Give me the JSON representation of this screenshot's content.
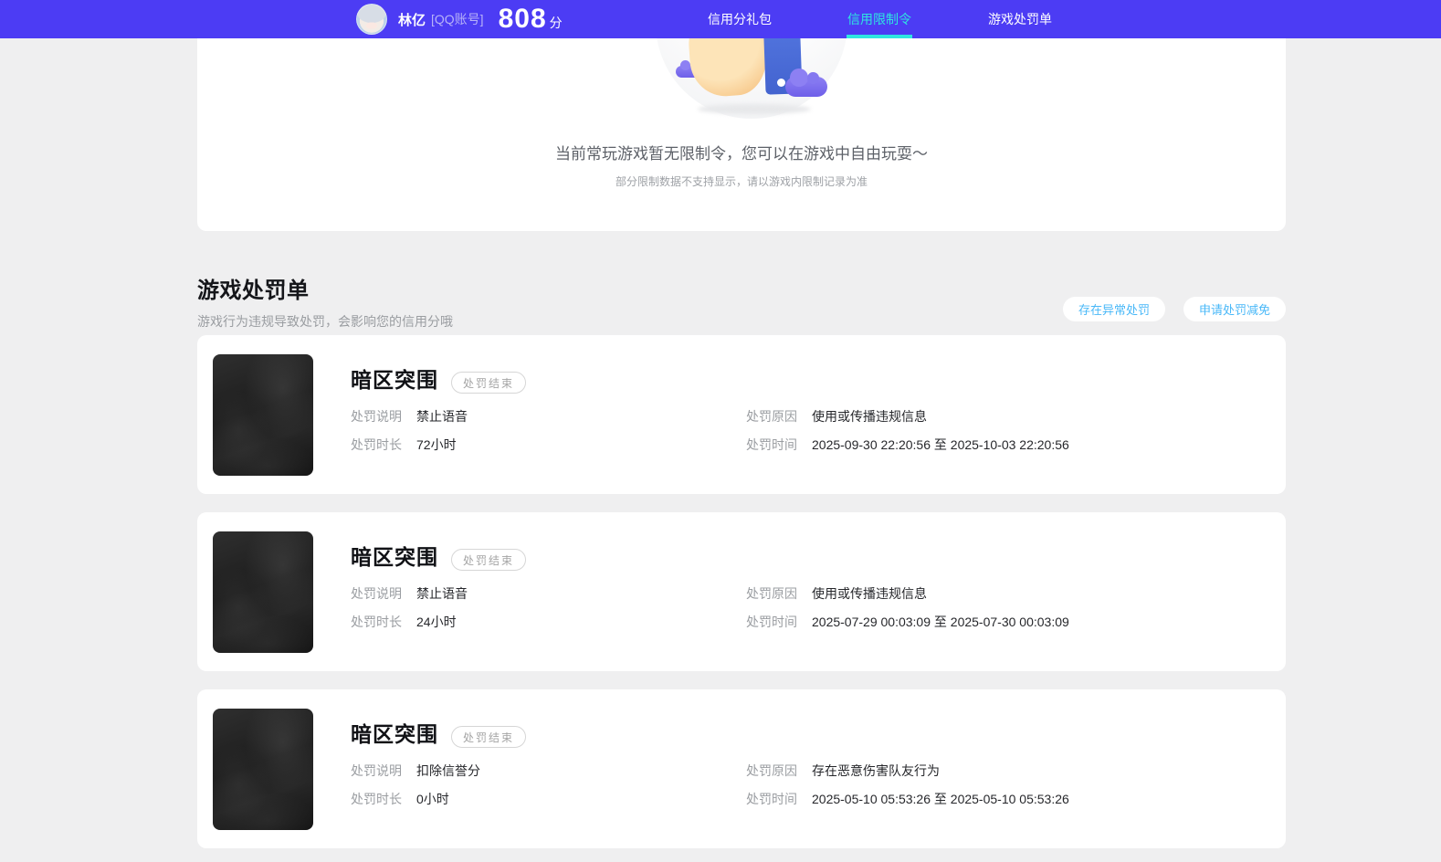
{
  "colors": {
    "navbar_bg": "#4c3cf4",
    "accent_cyan": "#2ee6e0",
    "action_blue": "#49b8f8",
    "page_bg": "#efeff0",
    "card_bg": "#ffffff"
  },
  "navbar": {
    "user": {
      "name": "林亿",
      "account_type": "[QQ账号]",
      "score": "808",
      "score_unit": "分"
    },
    "tabs": [
      {
        "label": "信用分礼包",
        "active": false
      },
      {
        "label": "信用限制令",
        "active": true
      },
      {
        "label": "游戏处罚单",
        "active": false
      }
    ]
  },
  "restriction_panel": {
    "message": "当前常玩游戏暂无限制令，您可以在游戏中自由玩耍～",
    "note": "部分限制数据不支持显示，请以游戏内限制记录为准"
  },
  "penalty_section": {
    "title": "游戏处罚单",
    "subtitle": "游戏行为违规导致处罚，会影响您的信用分哦",
    "actions": [
      {
        "label": "存在异常处罚"
      },
      {
        "label": "申请处罚减免"
      }
    ]
  },
  "field_labels": {
    "desc": "处罚说明",
    "duration": "处罚时长",
    "reason": "处罚原因",
    "time": "处罚时间"
  },
  "penalty_cards": [
    {
      "game": "暗区突围",
      "status": "处罚结束",
      "desc": "禁止语音",
      "duration": "72小时",
      "reason": "使用或传播违规信息",
      "time": "2025-09-30 22:20:56 至 2025-10-03 22:20:56"
    },
    {
      "game": "暗区突围",
      "status": "处罚结束",
      "desc": "禁止语音",
      "duration": "24小时",
      "reason": "使用或传播违规信息",
      "time": "2025-07-29 00:03:09 至 2025-07-30 00:03:09"
    },
    {
      "game": "暗区突围",
      "status": "处罚结束",
      "desc": "扣除信誉分",
      "duration": "0小时",
      "reason": "存在恶意伤害队友行为",
      "time": "2025-05-10 05:53:26 至 2025-05-10 05:53:26"
    }
  ]
}
